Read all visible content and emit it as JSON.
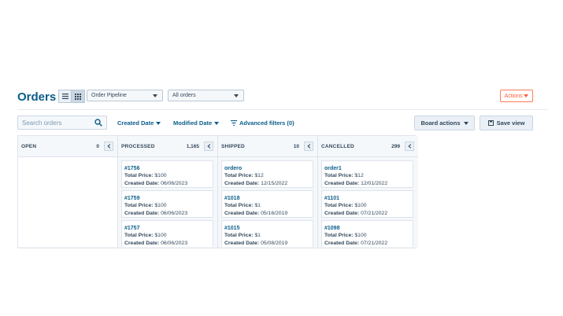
{
  "header": {
    "title": "Orders",
    "pipeline_select": "Order Pipeline",
    "view_select": "All orders",
    "actions_label": "Actions"
  },
  "filters": {
    "search_placeholder": "Search orders",
    "created_date": "Created Date",
    "modified_date": "Modified Date",
    "advanced": "Advanced filters (0)",
    "board_actions": "Board actions",
    "save_view": "Save view"
  },
  "board": {
    "columns": [
      {
        "name": "OPEN",
        "count": "0",
        "cards": []
      },
      {
        "name": "PROCESSED",
        "count": "1,165",
        "cards": [
          {
            "id": "#1756",
            "price": "$100",
            "date": "06/06/2023"
          },
          {
            "id": "#1759",
            "price": "$100",
            "date": "06/06/2023"
          },
          {
            "id": "#1757",
            "price": "$100",
            "date": "06/06/2023"
          }
        ]
      },
      {
        "name": "SHIPPED",
        "count": "10",
        "cards": [
          {
            "id": "ordero",
            "price": "$12",
            "date": "12/15/2022"
          },
          {
            "id": "#1018",
            "price": "$1",
            "date": "05/16/2019"
          },
          {
            "id": "#1015",
            "price": "$1",
            "date": "05/08/2019"
          }
        ]
      },
      {
        "name": "CANCELLED",
        "count": "299",
        "cards": [
          {
            "id": "order1",
            "price": "$12",
            "date": "12/01/2022"
          },
          {
            "id": "#1101",
            "price": "$100",
            "date": "07/21/2022"
          },
          {
            "id": "#1098",
            "price": "$100",
            "date": "07/21/2022"
          }
        ]
      }
    ],
    "labels": {
      "price": "Total Price:",
      "date": "Created Date:"
    }
  },
  "icons": {
    "list_view": "list-icon",
    "board_view": "grid-icon",
    "search": "search-icon",
    "filter": "filter-lines-icon",
    "save": "save-icon",
    "collapse": "chevron-left-icon"
  },
  "colors": {
    "link": "#0b5d8a",
    "accent": "#ff5c35",
    "border": "#dfe3eb"
  }
}
